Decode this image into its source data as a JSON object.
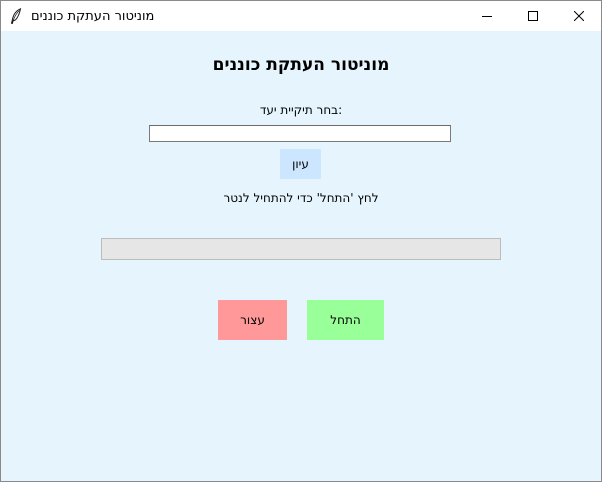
{
  "window": {
    "title": "מוניטור העתקת כוננים",
    "app_icon": "feather-icon",
    "controls": {
      "minimize_icon": "minimize-icon",
      "maximize_icon": "maximize-icon",
      "close_icon": "close-icon"
    }
  },
  "main": {
    "heading": "מוניטור העתקת כוננים",
    "folder_label": ":בחר תיקיית יעד",
    "folder_input": {
      "value": "",
      "placeholder": ""
    },
    "browse_label": "עיון",
    "status_text": "לחץ 'התחל' כדי להתחיל לנטר",
    "progress_fraction": 0,
    "stop_label": "עצור",
    "start_label": "התחל"
  },
  "colors": {
    "background": "#e6f5fd",
    "browse_button": "#cde6ff",
    "stop_button": "#ff9999",
    "start_button": "#99ff99",
    "progress_track": "#e6e6e6"
  }
}
